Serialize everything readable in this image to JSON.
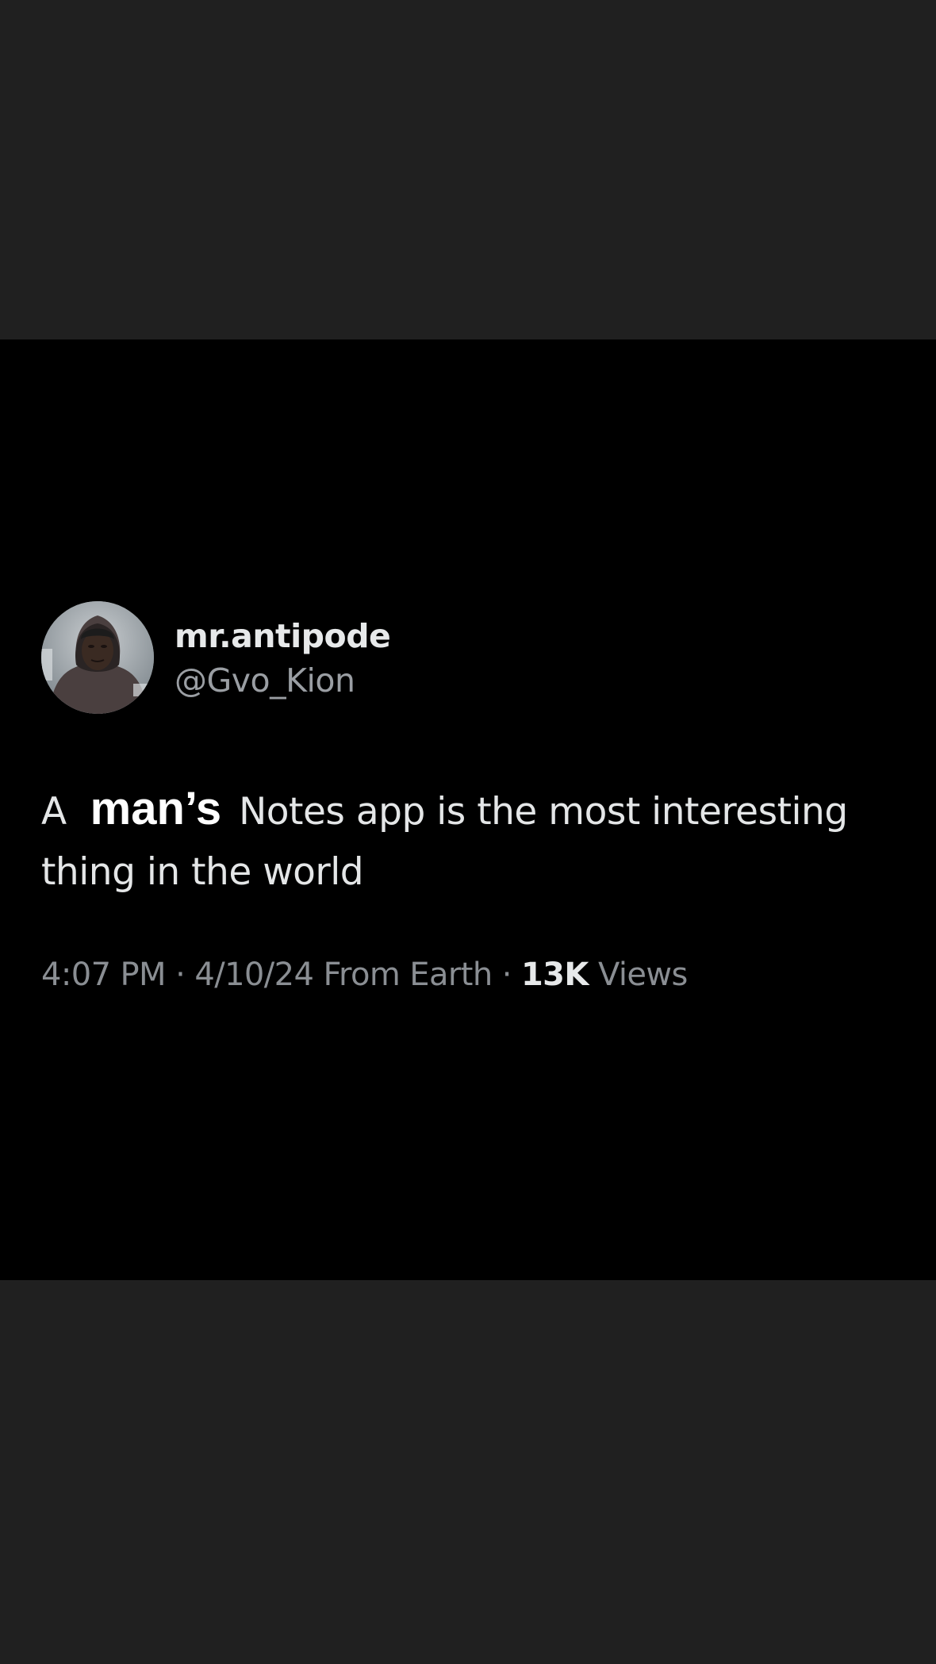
{
  "tweet": {
    "display_name": "mr.antipode",
    "handle": "@Gvo_Kion",
    "text_before": "A",
    "text_emphasis": "man’s",
    "text_after": "Notes app is the most interesting thing in the world",
    "time": "4:07 PM",
    "date": "4/10/24",
    "location": "From Earth",
    "separator": "·",
    "views_count": "13K",
    "views_label": "Views"
  },
  "colors": {
    "page_background": "#202020",
    "card_background": "#000000",
    "primary_text": "#e7e9ea",
    "secondary_text": "#8a8e93"
  },
  "icons": {
    "avatar": "profile-photo-avatar"
  }
}
